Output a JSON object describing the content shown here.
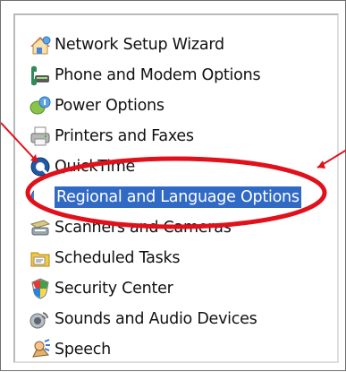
{
  "control_panel_list": {
    "items": [
      {
        "label": "Network Setup Wizard",
        "icon": "network-setup-wizard-icon",
        "selected": false
      },
      {
        "label": "Phone and Modem Options",
        "icon": "phone-modem-icon",
        "selected": false
      },
      {
        "label": "Power Options",
        "icon": "power-options-icon",
        "selected": false
      },
      {
        "label": "Printers and Faxes",
        "icon": "printer-fax-icon",
        "selected": false
      },
      {
        "label": "QuickTime",
        "icon": "quicktime-icon",
        "selected": false
      },
      {
        "label": "Regional and Language Options",
        "icon": "globe-icon",
        "selected": true
      },
      {
        "label": "Scanners and Cameras",
        "icon": "scanner-camera-icon",
        "selected": false
      },
      {
        "label": "Scheduled Tasks",
        "icon": "scheduled-tasks-icon",
        "selected": false
      },
      {
        "label": "Security Center",
        "icon": "security-shield-icon",
        "selected": false
      },
      {
        "label": "Sounds and Audio Devices",
        "icon": "speaker-icon",
        "selected": false
      },
      {
        "label": "Speech",
        "icon": "speech-icon",
        "selected": false
      }
    ]
  },
  "colors": {
    "selection_background": "#316ac5",
    "selection_text": "#ffffff",
    "annotation": "#e0111b",
    "panel_border": "#b9b9b9"
  }
}
